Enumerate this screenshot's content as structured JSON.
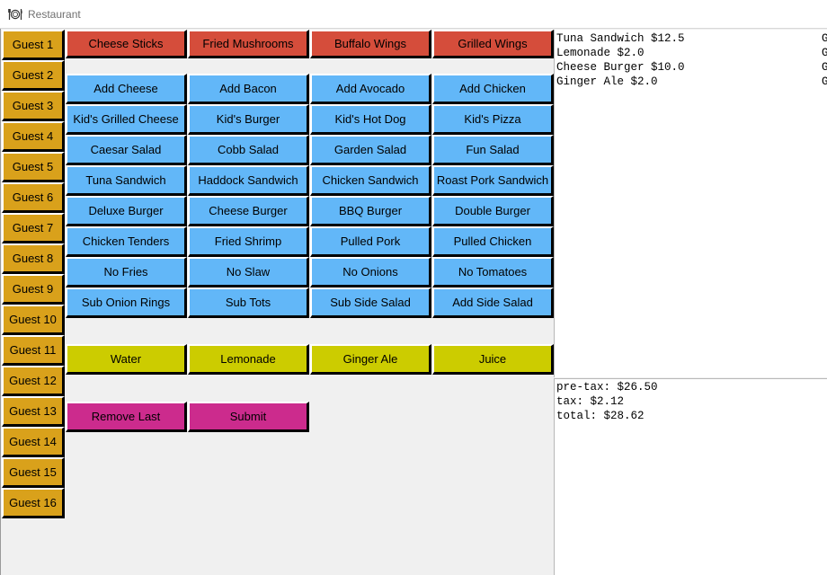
{
  "window": {
    "title": "Restaurant"
  },
  "guests": [
    "Guest 1",
    "Guest 2",
    "Guest 3",
    "Guest 4",
    "Guest 5",
    "Guest 6",
    "Guest 7",
    "Guest 8",
    "Guest 9",
    "Guest 10",
    "Guest 11",
    "Guest 12",
    "Guest 13",
    "Guest 14",
    "Guest 15",
    "Guest 16"
  ],
  "appetizers": [
    "Cheese Sticks",
    "Fried Mushrooms",
    "Buffalo Wings",
    "Grilled Wings"
  ],
  "menu": [
    [
      "Add Cheese",
      "Add Bacon",
      "Add Avocado",
      "Add Chicken"
    ],
    [
      "Kid's Grilled Cheese",
      "Kid's Burger",
      "Kid's Hot Dog",
      "Kid's Pizza"
    ],
    [
      "Caesar Salad",
      "Cobb Salad",
      "Garden Salad",
      "Fun Salad"
    ],
    [
      "Tuna Sandwich",
      "Haddock Sandwich",
      "Chicken Sandwich",
      "Roast Pork Sandwich"
    ],
    [
      "Deluxe Burger",
      "Cheese Burger",
      "BBQ Burger",
      "Double Burger"
    ],
    [
      "Chicken Tenders",
      "Fried Shrimp",
      "Pulled Pork",
      "Pulled Chicken"
    ],
    [
      "No Fries",
      "No Slaw",
      "No Onions",
      "No Tomatoes"
    ],
    [
      "Sub Onion Rings",
      "Sub Tots",
      "Sub Side Salad",
      "Add Side Salad"
    ]
  ],
  "drinks": [
    "Water",
    "Lemonade",
    "Ginger Ale",
    "Juice"
  ],
  "actions": {
    "remove_last": "Remove Last",
    "submit": "Submit"
  },
  "order_lines": [
    {
      "item": "Tuna Sandwich $12.5",
      "guest": "G"
    },
    {
      "item": "Lemonade $2.0",
      "guest": "G"
    },
    {
      "item": "Cheese Burger $10.0",
      "guest": "G"
    },
    {
      "item": "Ginger Ale $2.0",
      "guest": "G"
    }
  ],
  "totals": {
    "pretax": "pre-tax: $26.50",
    "tax": "tax: $2.12",
    "total": "total: $28.62"
  },
  "colors": {
    "guest": "#d9a11b",
    "appetizer": "#d54d3b",
    "menu": "#62b7f8",
    "drink": "#cccc00",
    "action": "#cc2b8d"
  },
  "icons": {
    "app": "plate-cutlery-icon"
  }
}
